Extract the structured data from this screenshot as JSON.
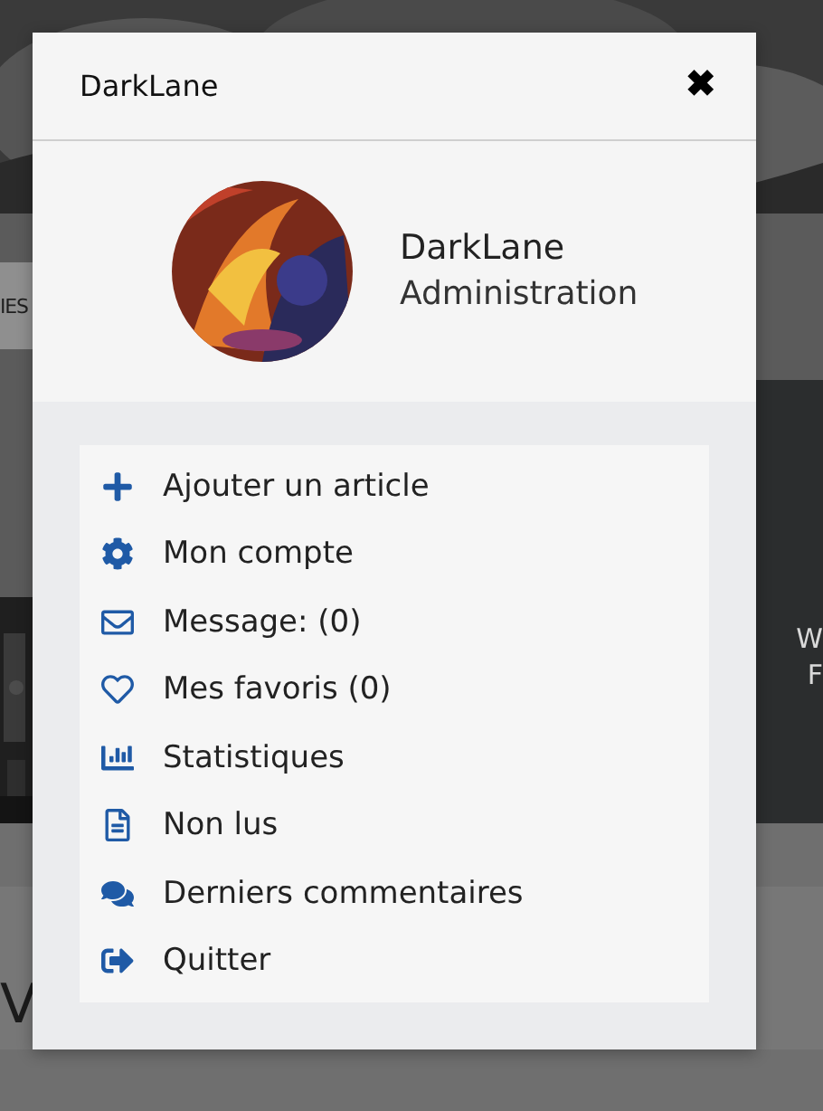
{
  "background": {
    "left_text": "IES",
    "right_texts": [
      "W",
      "F"
    ],
    "bottom_text": "V"
  },
  "modal": {
    "title": "DarkLane",
    "close": "✖",
    "profile": {
      "name": "DarkLane",
      "role": "Administration"
    },
    "menu": [
      {
        "label": "Ajouter un article"
      },
      {
        "label": "Mon compte"
      },
      {
        "label": "Message: (0)"
      },
      {
        "label": "Mes favoris (0)"
      },
      {
        "label": "Statistiques"
      },
      {
        "label": "Non lus"
      },
      {
        "label": "Derniers commentaires"
      },
      {
        "label": "Quitter"
      }
    ]
  }
}
